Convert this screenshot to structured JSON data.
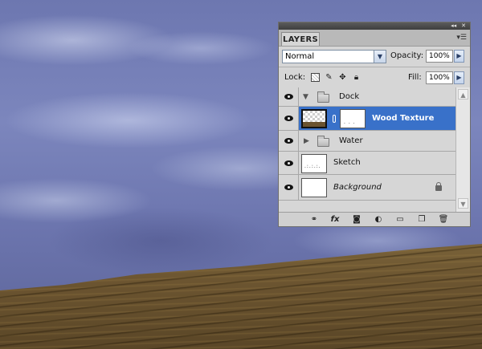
{
  "panel": {
    "tab_label": "LAYERS",
    "collapse_glyph": "◂◂",
    "close_glyph": "✕",
    "menu_glyph": "▾☰",
    "blend_mode": "Normal",
    "opacity_label": "Opacity:",
    "opacity_value": "100%",
    "lock_label": "Lock:",
    "fill_label": "Fill:",
    "fill_value": "100%"
  },
  "layers": [
    {
      "name": "Dock",
      "type": "group",
      "expanded": true,
      "visible": true
    },
    {
      "name": "Wood Texture",
      "type": "layer-with-mask",
      "selected": true,
      "visible": true
    },
    {
      "name": "Water",
      "type": "group",
      "expanded": false,
      "visible": true
    },
    {
      "name": "Sketch",
      "type": "layer",
      "visible": true
    },
    {
      "name": "Background",
      "type": "background",
      "locked": true,
      "visible": true
    }
  ],
  "footer_icons": [
    "link-layers-icon",
    "fx-icon",
    "add-mask-icon",
    "adjustment-layer-icon",
    "new-group-icon",
    "new-layer-icon",
    "trash-icon"
  ],
  "footer_glyphs": {
    "fx": "fx"
  },
  "colors": {
    "selection": "#3971c9",
    "sky": "#6d77b0",
    "wood": "#6b5430"
  }
}
